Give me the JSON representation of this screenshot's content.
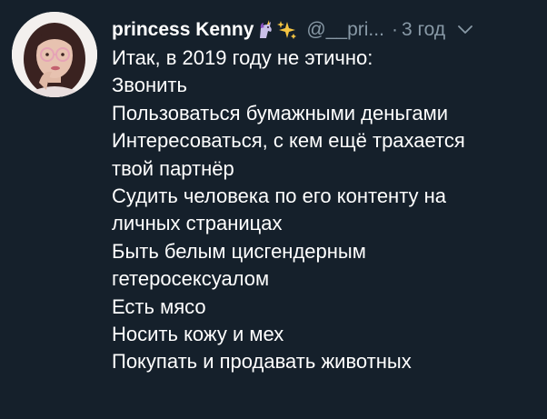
{
  "tweet": {
    "display_name": "princess Kenny",
    "emojis": [
      "unicorn-emoji",
      "sparkles-emoji"
    ],
    "handle": "@__pri...",
    "separator": "·",
    "timestamp": "3 год",
    "menu_icon": "chevron-down-icon",
    "lines": [
      "Итак, в 2019 году не этично:",
      "Звонить",
      "Пользоваться бумажными деньгами",
      "Интересоваться, с кем ещё трахается",
      "твой партнёр",
      "Судить человека по его контенту на",
      "личных страницах",
      "Быть белым цисгендерным",
      "гетеросексуалом",
      "Есть мясо",
      "Носить кожу и мех",
      "Покупать и продавать животных"
    ]
  },
  "colors": {
    "background": "#15202b",
    "text": "#ffffff",
    "secondary_text": "#8899a6"
  }
}
